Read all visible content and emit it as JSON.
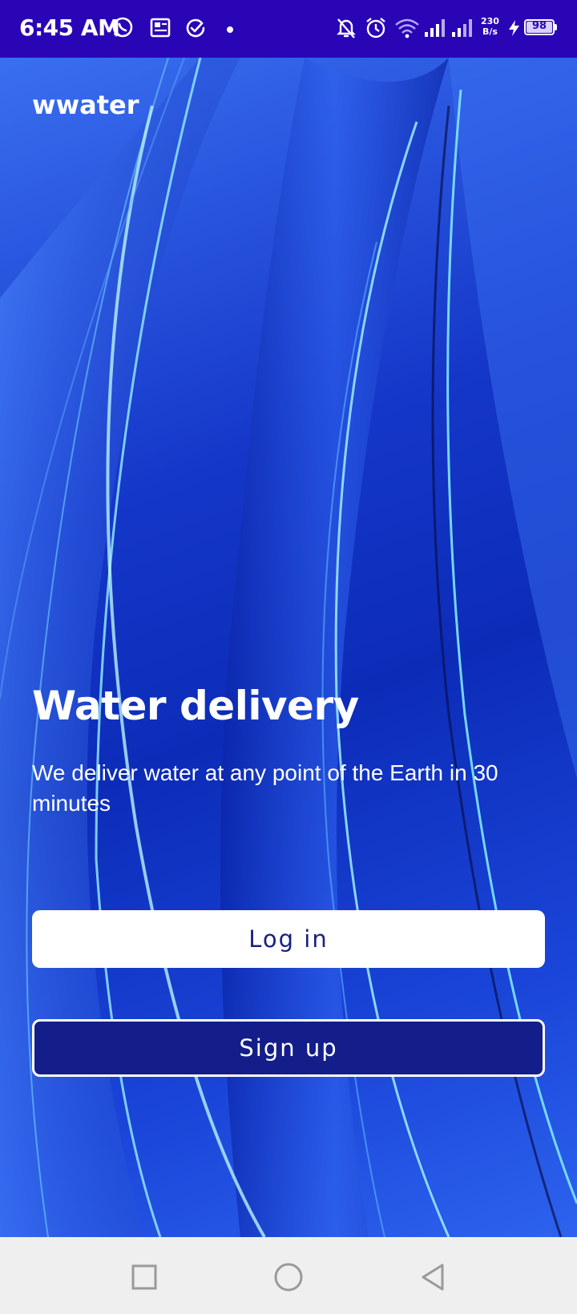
{
  "status_bar": {
    "time": "6:45 AM",
    "net_speed_value": "230",
    "net_speed_unit": "B/s",
    "battery_level": "98",
    "icons": [
      "whatsapp-icon",
      "news-icon",
      "check-circle-icon",
      "dot-icon",
      "notifications-off-icon",
      "alarm-icon",
      "wifi-icon",
      "signal-icon",
      "signal-icon",
      "charging-icon",
      "battery-icon"
    ]
  },
  "app": {
    "brand": "wwater",
    "headline": "Water delivery",
    "subtitle": "We deliver water at any point of the Earth in 30 minutes",
    "login_label": "Log in",
    "signup_label": "Sign up"
  },
  "nav_bar": {
    "icons": [
      "recents-square-icon",
      "home-circle-icon",
      "back-triangle-icon"
    ]
  },
  "colors": {
    "status_bar_bg": "#2a05b6",
    "signup_bg": "#141e8a",
    "login_text": "#1a2080",
    "nav_bg": "#efefef"
  }
}
